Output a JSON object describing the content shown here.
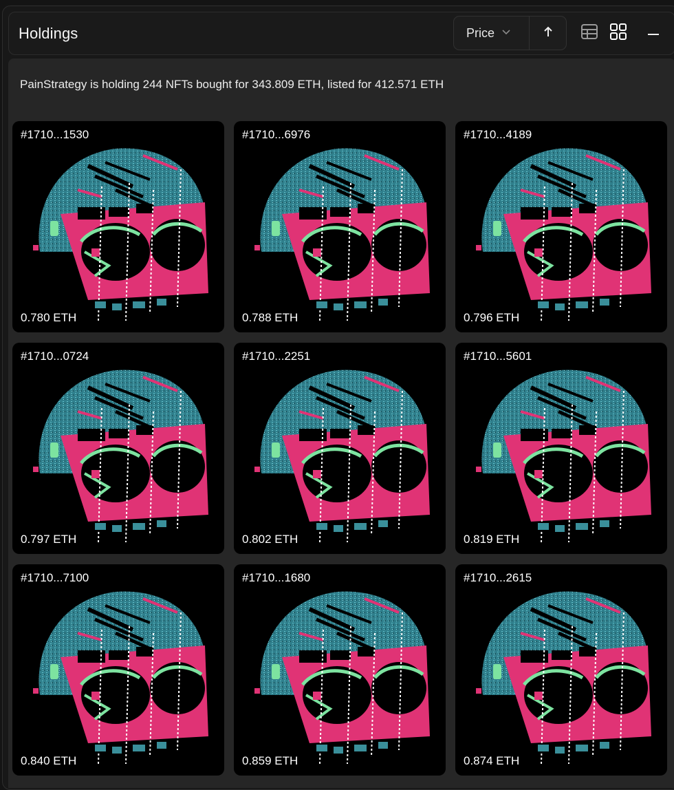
{
  "panel": {
    "title": "Holdings",
    "sort": {
      "label": "Price",
      "direction_icon": "arrow-up-icon"
    },
    "view_modes": [
      "table-view-icon",
      "grid-view-icon"
    ],
    "active_view": "grid",
    "collapse_icon": "minus-icon"
  },
  "summary": {
    "text": "PainStrategy is holding 244 NFTs bought for 343.809 ETH, listed for 412.571 ETH"
  },
  "colors": {
    "pink": "#e03375",
    "teal": "#3a8f9a",
    "green": "#7de3a0",
    "background": "#262626"
  },
  "nfts": [
    {
      "id": "#1710...1530",
      "price": "0.780 ETH"
    },
    {
      "id": "#1710...6976",
      "price": "0.788 ETH"
    },
    {
      "id": "#1710...4189",
      "price": "0.796 ETH"
    },
    {
      "id": "#1710...0724",
      "price": "0.797 ETH"
    },
    {
      "id": "#1710...2251",
      "price": "0.802 ETH"
    },
    {
      "id": "#1710...5601",
      "price": "0.819 ETH"
    },
    {
      "id": "#1710...7100",
      "price": "0.840 ETH"
    },
    {
      "id": "#1710...1680",
      "price": "0.859 ETH"
    },
    {
      "id": "#1710...2615",
      "price": "0.874 ETH"
    }
  ]
}
